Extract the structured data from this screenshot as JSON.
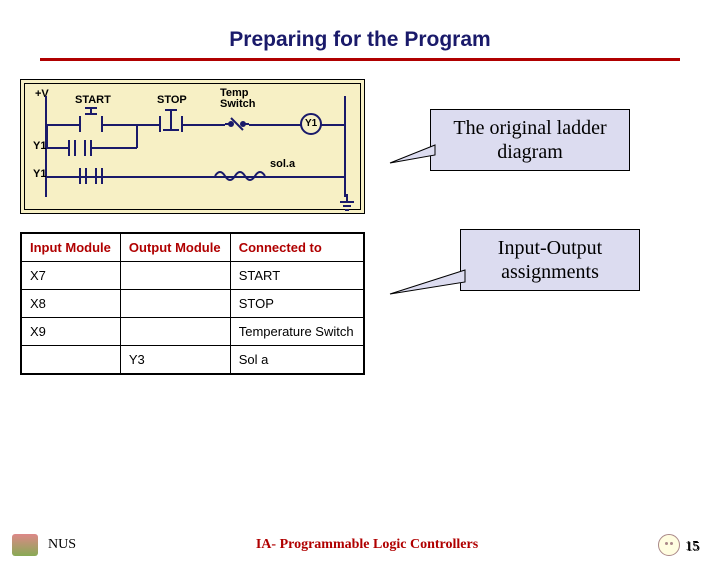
{
  "title": "Preparing for the Program",
  "callouts": {
    "ladder": "The original ladder diagram",
    "io": "Input-Output assignments"
  },
  "ladder": {
    "rail_plus": "+V",
    "labels": {
      "start": "START",
      "stop": "STOP",
      "temp": "Temp Switch",
      "y1_out": "Y1",
      "y1_branch": "Y1",
      "y1_in": "Y1",
      "sol": "sol.a"
    }
  },
  "io_table": {
    "headers": [
      "Input Module",
      "Output Module",
      "Connected to"
    ],
    "rows": [
      [
        "X7",
        "",
        "START"
      ],
      [
        "X8",
        "",
        "STOP"
      ],
      [
        "X9",
        "",
        "Temperature Switch"
      ],
      [
        "",
        "Y3",
        "Sol a"
      ]
    ]
  },
  "footer": {
    "uni": "NUS",
    "center": "IA- Programmable Logic Controllers",
    "page": "15"
  }
}
